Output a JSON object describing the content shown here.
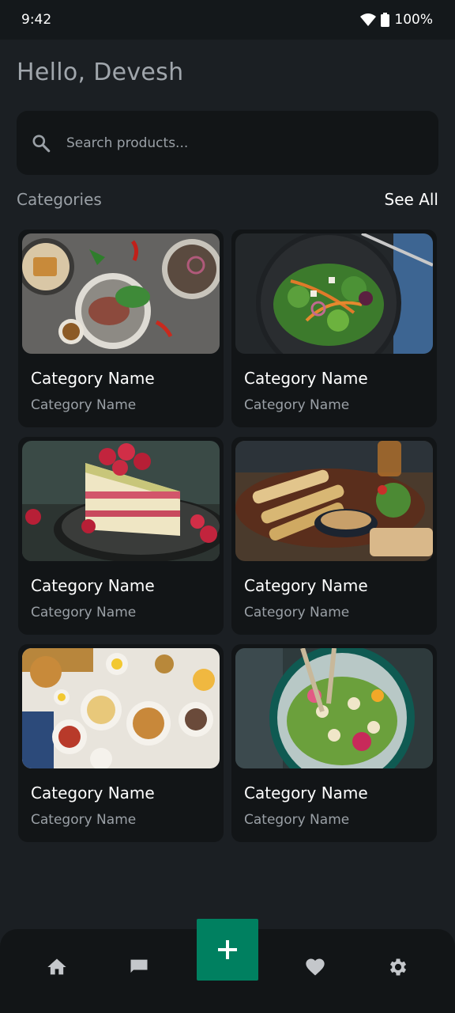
{
  "status_bar": {
    "time": "9:42",
    "battery": "100%"
  },
  "greeting": "Hello, Devesh",
  "search": {
    "placeholder": "Search products..."
  },
  "categories": {
    "title": "Categories",
    "see_all": "See All",
    "items": [
      {
        "name": "Category Name",
        "subtitle": "Category Name",
        "image": "grilled-meat-platter"
      },
      {
        "name": "Category Name",
        "subtitle": "Category Name",
        "image": "salad-bowl"
      },
      {
        "name": "Category Name",
        "subtitle": "Category Name",
        "image": "raspberry-cake-slice"
      },
      {
        "name": "Category Name",
        "subtitle": "Category Name",
        "image": "kebab-platter"
      },
      {
        "name": "Category Name",
        "subtitle": "Category Name",
        "image": "brunch-table"
      },
      {
        "name": "Category Name",
        "subtitle": "Category Name",
        "image": "grain-salad-bowl"
      }
    ]
  },
  "bottom_nav": {
    "items": [
      "home-icon",
      "chat-icon",
      "add-icon",
      "heart-icon",
      "settings-icon"
    ]
  },
  "colors": {
    "background": "#1b1f23",
    "surface": "#121517",
    "accent": "#008060",
    "muted_text": "#9aa0a6"
  }
}
